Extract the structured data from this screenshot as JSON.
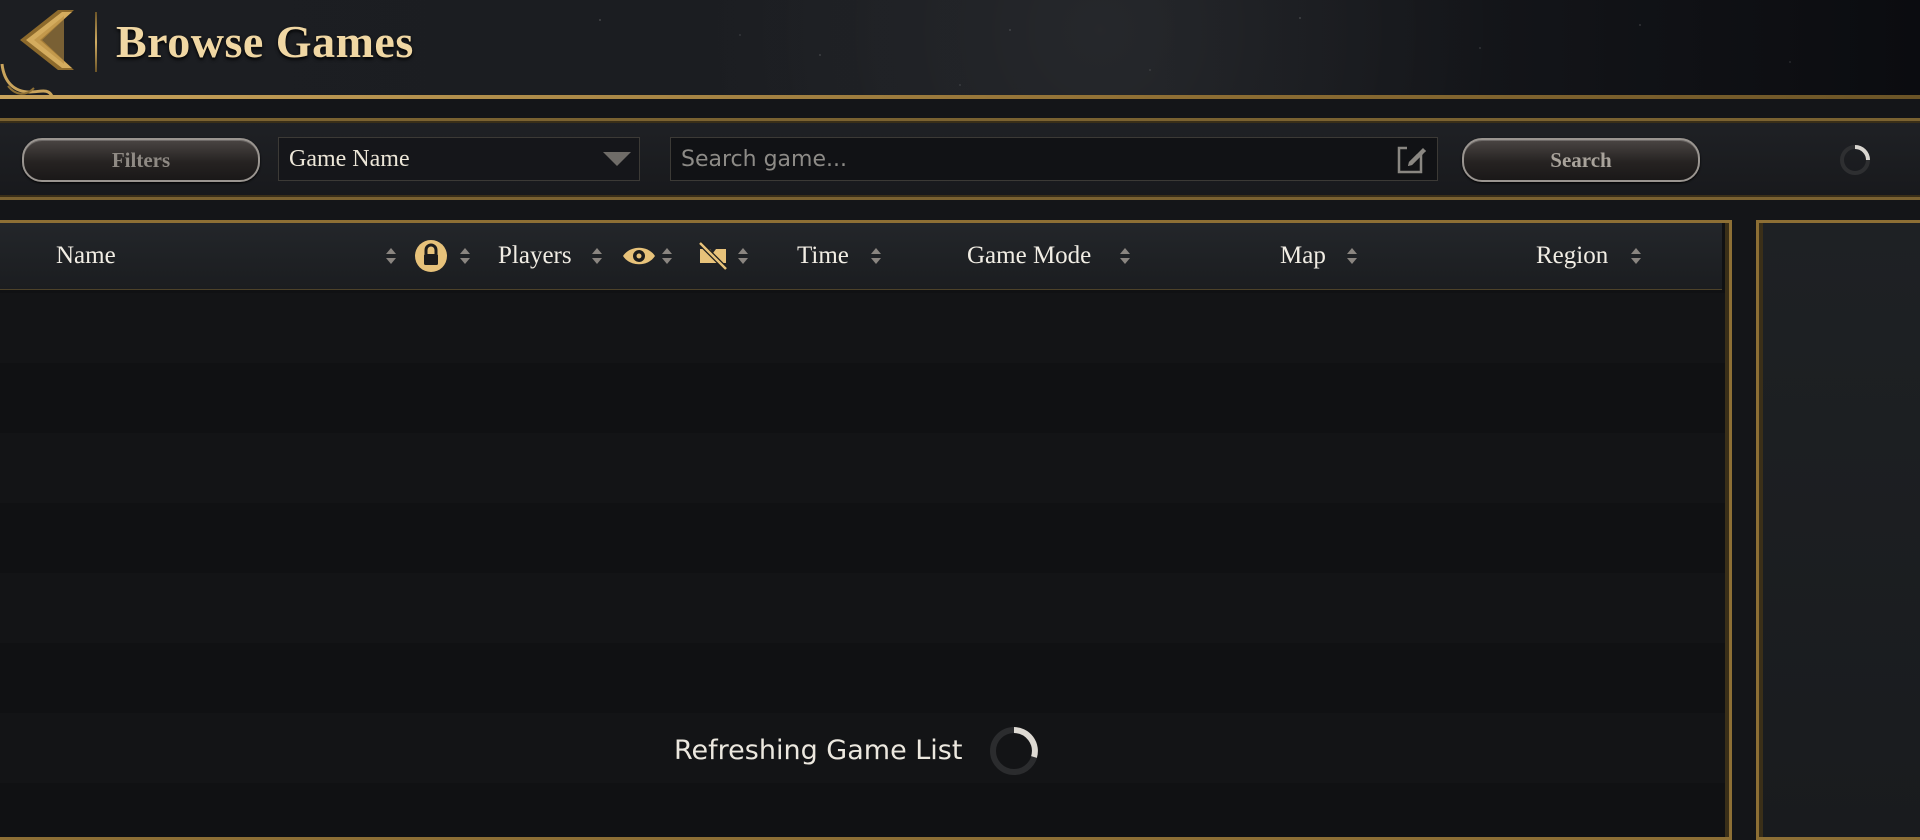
{
  "header": {
    "title": "Browse Games",
    "back_icon": "chevron-left-icon"
  },
  "toolbar": {
    "filters_label": "Filters",
    "search_field_select": {
      "selected": "Game Name"
    },
    "search_input": {
      "placeholder": "Search game...",
      "value": ""
    },
    "search_label": "Search"
  },
  "table": {
    "columns": [
      {
        "label": "Name"
      },
      {
        "icon": "lock-icon"
      },
      {
        "label": "Players"
      },
      {
        "icon": "eye-icon"
      },
      {
        "icon": "mods-disabled-icon"
      },
      {
        "label": "Time"
      },
      {
        "label": "Game Mode"
      },
      {
        "label": "Map"
      },
      {
        "label": "Region"
      }
    ],
    "rows": []
  },
  "status": {
    "loading_text": "Refreshing Game List"
  },
  "colors": {
    "gold_accent": "#c9a45c",
    "title_text": "#f0d7a3",
    "panel_bg": "#101113"
  }
}
